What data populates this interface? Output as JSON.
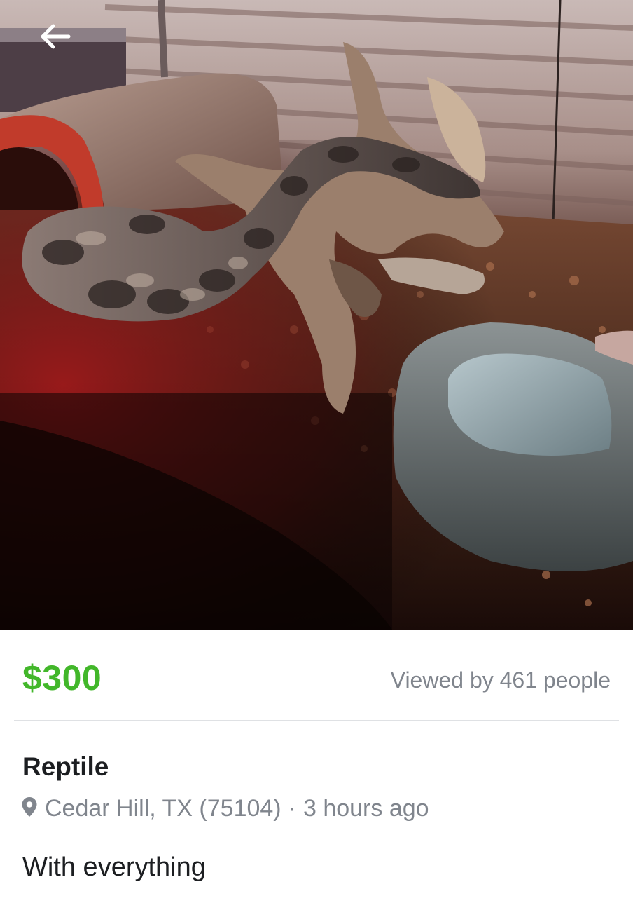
{
  "photo": {
    "alt": "Ball python in a terrarium with a hide log, driftwood and water dish"
  },
  "navigation": {
    "back_icon": "arrow-left-icon"
  },
  "listing": {
    "price": "$300",
    "views": "Viewed by 461 people",
    "title": "Reptile",
    "location_icon": "map-pin-icon",
    "location": "Cedar Hill, TX (75104)",
    "separator": "·",
    "posted": "3 hours ago",
    "description": "With everything"
  },
  "colors": {
    "price": "#42b72a",
    "secondary_text": "#80858d",
    "primary_text": "#1c1e21",
    "divider": "#dfe1e4"
  }
}
